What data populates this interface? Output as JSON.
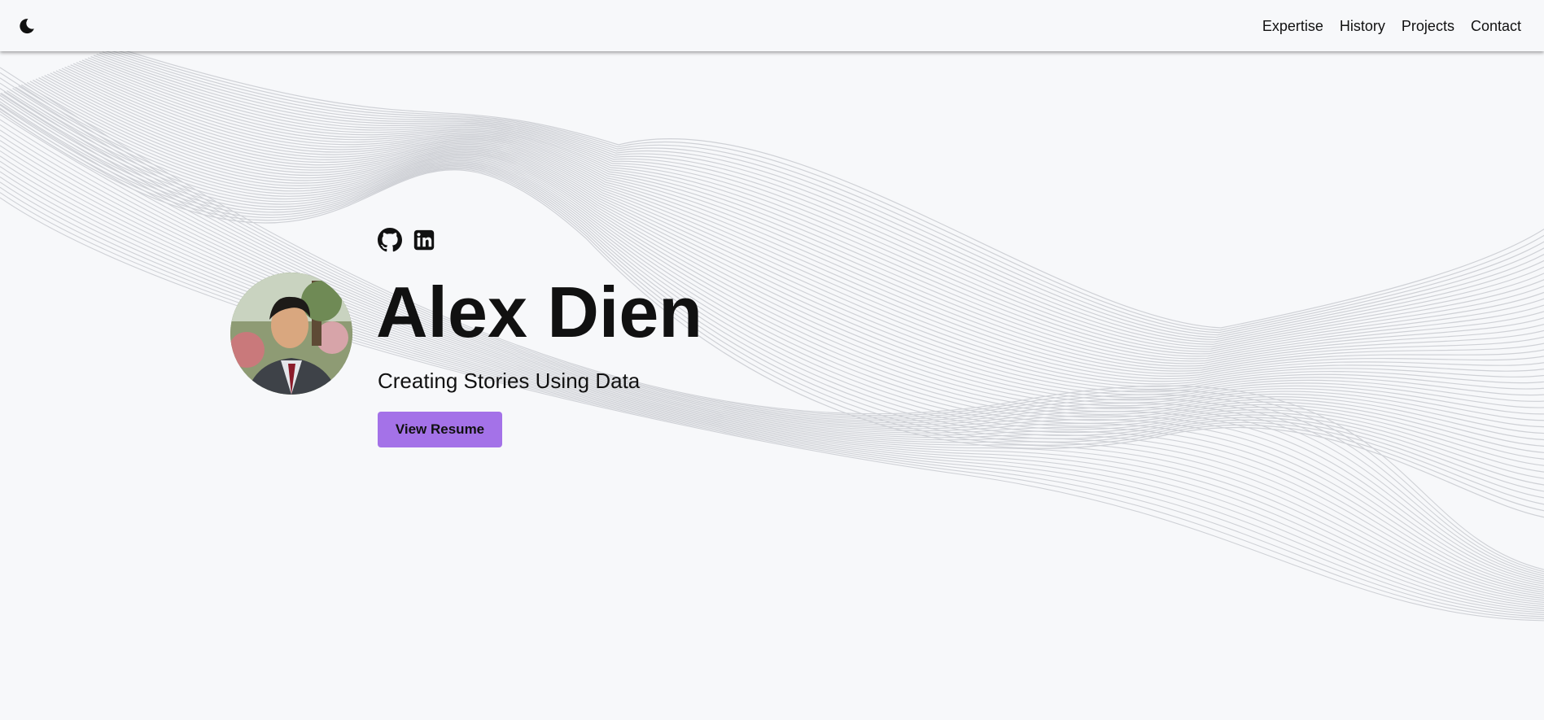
{
  "header": {
    "theme_toggle_icon": "moon-icon",
    "nav": [
      {
        "label": "Expertise"
      },
      {
        "label": "History"
      },
      {
        "label": "Projects"
      },
      {
        "label": "Contact"
      }
    ]
  },
  "hero": {
    "social": [
      {
        "icon": "github-icon"
      },
      {
        "icon": "linkedin-icon"
      }
    ],
    "avatar_icon": "profile-photo",
    "name": "Alex Dien",
    "tagline": "Creating Stories Using Data",
    "resume_label": "View Resume"
  },
  "colors": {
    "background": "#f7f8fa",
    "accent": "#a472e8",
    "wave_lines": "#cfd1d6",
    "text": "#111111"
  }
}
